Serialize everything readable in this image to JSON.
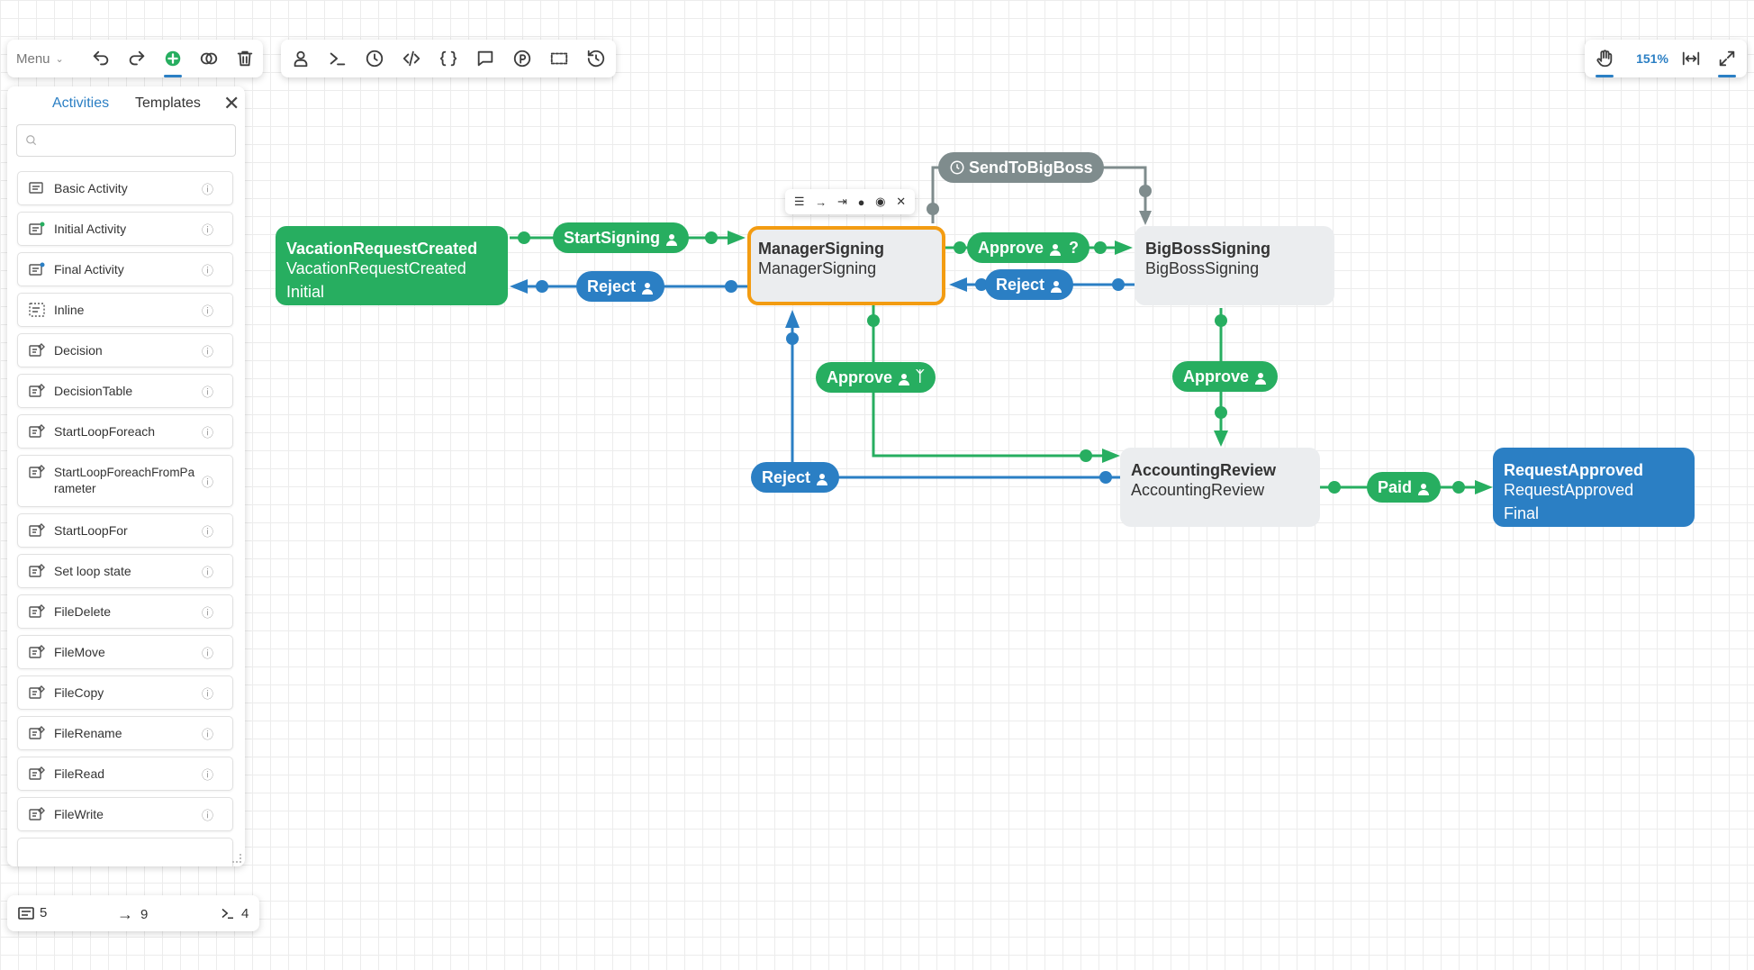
{
  "toolbar": {
    "menu_label": "Menu"
  },
  "zoom": {
    "level": "151%"
  },
  "sidebar": {
    "tab_activities": "Activities",
    "tab_templates": "Templates",
    "search_placeholder": "",
    "items": [
      {
        "label": "Basic Activity"
      },
      {
        "label": "Initial Activity"
      },
      {
        "label": "Final Activity"
      },
      {
        "label": "Inline"
      },
      {
        "label": "Decision"
      },
      {
        "label": "DecisionTable"
      },
      {
        "label": "StartLoopForeach"
      },
      {
        "label": "StartLoopForeachFromPa rameter"
      },
      {
        "label": "StartLoopFor"
      },
      {
        "label": "Set loop state"
      },
      {
        "label": "FileDelete"
      },
      {
        "label": "FileMove"
      },
      {
        "label": "FileCopy"
      },
      {
        "label": "FileRename"
      },
      {
        "label": "FileRead"
      },
      {
        "label": "FileWrite"
      }
    ]
  },
  "stats": {
    "activities": "5",
    "transitions": "9",
    "commands": "4"
  },
  "nodes": {
    "vacation": {
      "name": "VacationRequestCreated",
      "sub": "VacationRequestCreated",
      "type": "Initial"
    },
    "manager": {
      "name": "ManagerSigning",
      "sub": "ManagerSigning"
    },
    "bigboss": {
      "name": "BigBossSigning",
      "sub": "BigBossSigning"
    },
    "accounting": {
      "name": "AccountingReview",
      "sub": "AccountingReview"
    },
    "approved": {
      "name": "RequestApproved",
      "sub": "RequestApproved",
      "type": "Final"
    }
  },
  "transitions": {
    "start_signing": "StartSigning",
    "reject_manager": "Reject",
    "approve_manager": "Approve",
    "reject_bigboss": "Reject",
    "send_to_bigboss": "SendToBigBoss",
    "approve_to_accounting": "Approve",
    "approve_bigboss": "Approve",
    "reject_accounting": "Reject",
    "paid": "Paid",
    "question_mark": "?"
  },
  "colors": {
    "green": "#27ae60",
    "blue": "#2b7fc4",
    "grey": "#7f8c8d",
    "selected": "#f39c12"
  }
}
